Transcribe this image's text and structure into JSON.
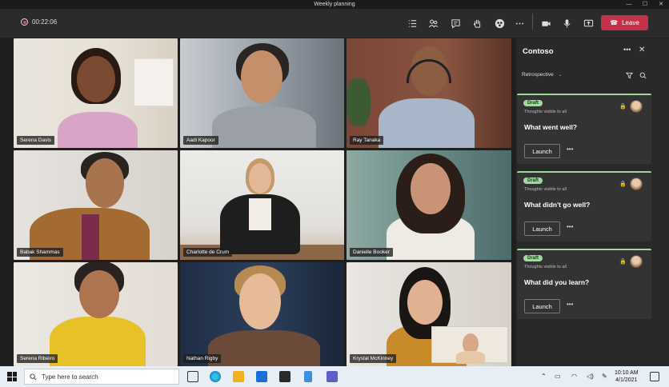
{
  "window": {
    "title": "Weekly planning"
  },
  "toolbar": {
    "timer": "00:22:06",
    "leave_label": "Leave",
    "colors": {
      "leave": "#c4314b"
    }
  },
  "participants": [
    {
      "name": "Serena Davis"
    },
    {
      "name": "Aadi Kapoor"
    },
    {
      "name": "Ray Tanaka"
    },
    {
      "name": "Babak Shammas"
    },
    {
      "name": "Charlotte de Crum"
    },
    {
      "name": "Danielle Booker"
    },
    {
      "name": "Serena Ribeiro"
    },
    {
      "name": "Nathan Rigby"
    },
    {
      "name": "Krystal McKinney"
    }
  ],
  "side_panel": {
    "title": "Contoso",
    "dropdown": "Retrospective",
    "cards": [
      {
        "badge": "Draft",
        "visibility": "Thoughts visible to all",
        "question": "What went well?",
        "launch": "Launch"
      },
      {
        "badge": "Draft",
        "visibility": "Thoughts visible to all",
        "question": "What didn't go well?",
        "launch": "Launch"
      },
      {
        "badge": "Draft",
        "visibility": "Thoughts visible to all",
        "question": "What did you learn?",
        "launch": "Launch"
      }
    ]
  },
  "taskbar": {
    "search_placeholder": "Type here to search",
    "time": "10:10 AM",
    "date": "4/1/2021"
  }
}
